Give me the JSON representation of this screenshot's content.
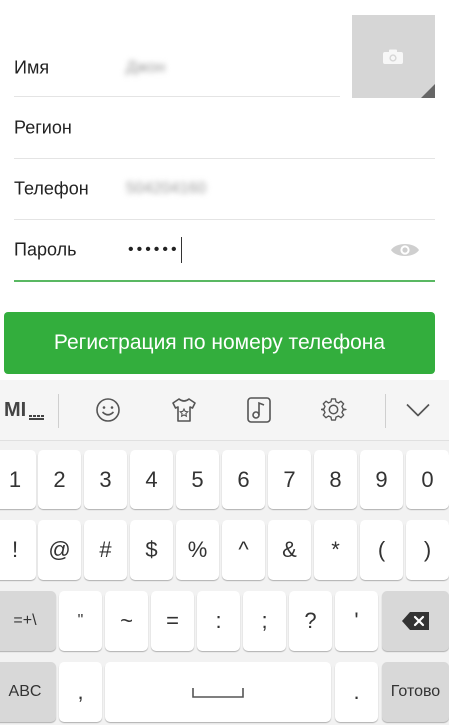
{
  "form": {
    "name_label": "Имя",
    "name_value": "Джон",
    "region_label": "Регион",
    "phone_label": "Телефон",
    "phone_value": "504204160",
    "password_label": "Пароль",
    "password_mask": "••••••"
  },
  "photo": {
    "icon": "camera-icon"
  },
  "register_button": {
    "label": "Регистрация по номеру телефона"
  },
  "colors": {
    "accent_green": "#33ae3d",
    "underline_green": "#59b862"
  },
  "keyboard": {
    "toolbar": {
      "items": [
        "keyboard-mode-icon",
        "emoji-icon",
        "theme-icon",
        "music-icon",
        "settings-icon",
        "hide-keyboard-icon"
      ]
    },
    "row1": [
      "1",
      "2",
      "3",
      "4",
      "5",
      "6",
      "7",
      "8",
      "9",
      "0"
    ],
    "row2": [
      "!",
      "@",
      "#",
      "$",
      "%",
      "^",
      "&",
      "*",
      "(",
      ")"
    ],
    "row3_left": "=+\\",
    "row3": [
      "\"",
      "~",
      "=",
      ":",
      ";",
      "?",
      "'"
    ],
    "row4_left": "ABC",
    "row4_comma": ",",
    "row4_period": ".",
    "row4_done": "Готово"
  }
}
